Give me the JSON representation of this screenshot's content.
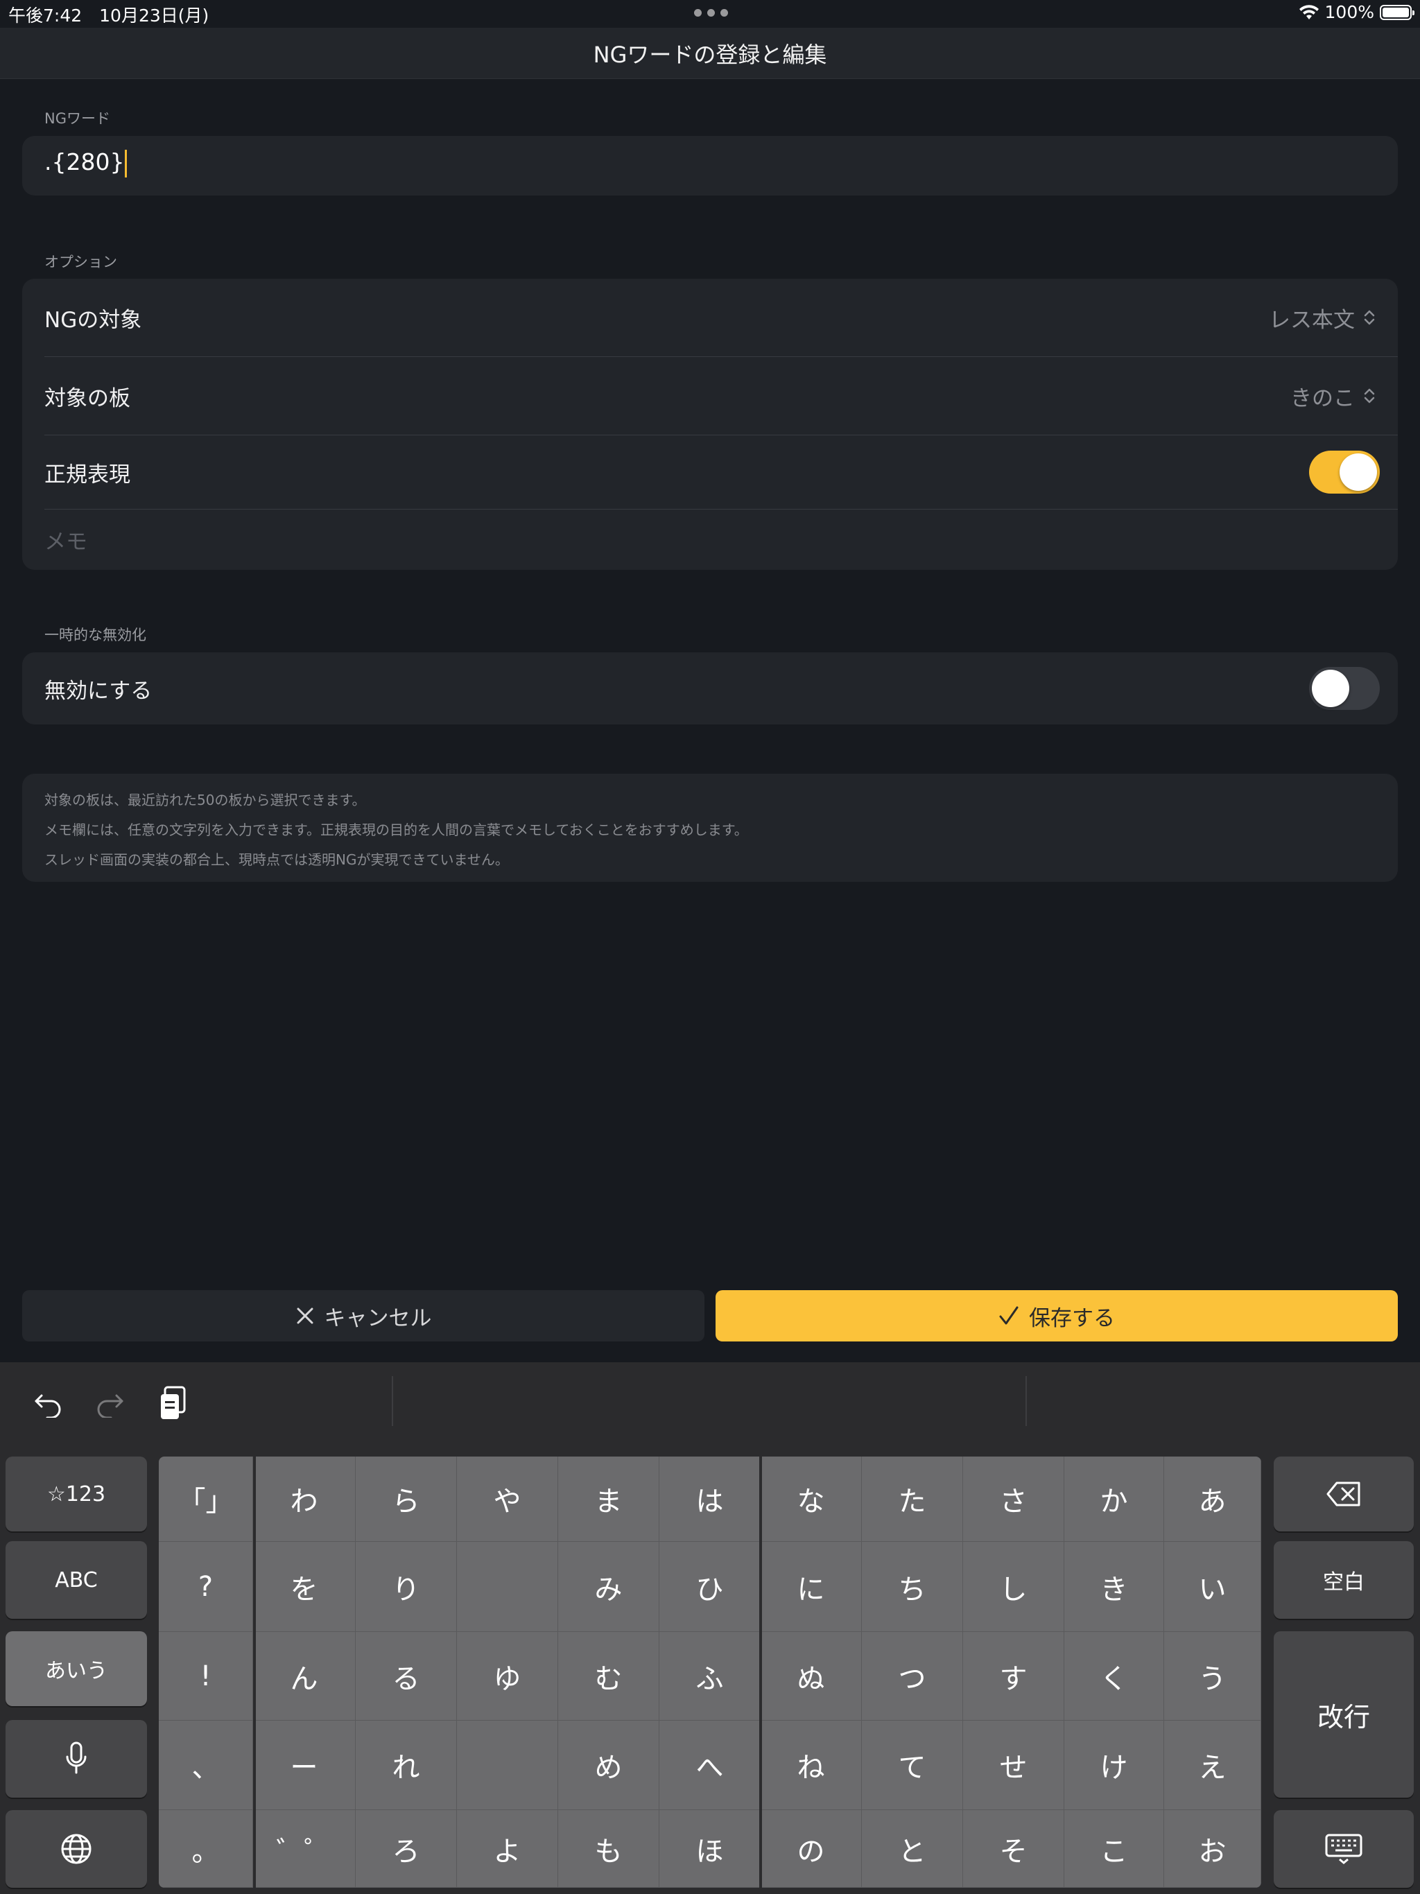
{
  "status": {
    "time": "午後7:42　10月23日(月)",
    "battery": "100%"
  },
  "nav": {
    "title": "NGワードの登録と編集"
  },
  "ngword": {
    "section": "NGワード",
    "value": ".{280}"
  },
  "options": {
    "section": "オプション",
    "target_label": "NGの対象",
    "target_value": "レス本文",
    "board_label": "対象の板",
    "board_value": "きのこ",
    "regex_label": "正規表現",
    "regex_on": true,
    "memo_placeholder": "メモ"
  },
  "disable": {
    "section": "一時的な無効化",
    "label": "無効にする",
    "on": false
  },
  "notes": [
    "対象の板は、最近訪れた50の板から選択できます。",
    "メモ欄には、任意の文字列を入力できます。正規表現の目的を人間の言葉でメモしておくことをおすすめします。",
    "スレッド画面の実装の都合上、現時点では透明NGが実現できていません。"
  ],
  "buttons": {
    "cancel": "キャンセル",
    "save": "保存する"
  },
  "accent_color": "#fbc23a",
  "keyboard": {
    "left_keys": [
      "☆123",
      "ABC",
      "あいう",
      "mic-icon",
      "globe-icon"
    ],
    "right_keys": [
      "delete-icon",
      "空白",
      "改行",
      "keyboard-dismiss-icon"
    ],
    "rows": [
      [
        "「」",
        "わ",
        "ら",
        "や",
        "ま",
        "は",
        "な",
        "た",
        "さ",
        "か",
        "あ"
      ],
      [
        "?",
        "を",
        "り",
        "",
        "み",
        "ひ",
        "に",
        "ち",
        "し",
        "き",
        "い"
      ],
      [
        "!",
        "ん",
        "る",
        "ゆ",
        "む",
        "ふ",
        "ぬ",
        "つ",
        "す",
        "く",
        "う"
      ],
      [
        "、",
        "ー",
        "れ",
        "",
        "め",
        "へ",
        "ね",
        "て",
        "せ",
        "け",
        "え"
      ],
      [
        "。",
        "゛゜",
        "ろ",
        "よ",
        "も",
        "ほ",
        "の",
        "と",
        "そ",
        "こ",
        "お"
      ]
    ]
  }
}
